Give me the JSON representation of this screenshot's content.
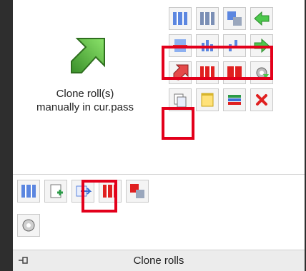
{
  "main": {
    "caption": "Clone roll(s)\nmanually in cur.pass",
    "big_icon": "clone-arrow-icon"
  },
  "grid": [
    [
      "columns-blue-icon",
      "columns-gray-icon",
      "roll-clone-stack-icon",
      "arrow-left-green-icon"
    ],
    [
      "align-center-vertical-icon",
      "align-bottom-icon",
      "align-top-icon",
      "arrow-right-green-icon"
    ],
    [
      "arrow-up-red-icon",
      "columns-red-split-icon",
      "columns-red-split-2-icon",
      "settings-arrow-icon"
    ],
    [
      "copy-pages-icon",
      "notepad-icon",
      "stack-colored-bars-icon",
      "close-red-x-icon"
    ]
  ],
  "bottom_row": [
    "columns-blue-3-icon",
    "add-roll-icon",
    "move-to-icon",
    "columns-red-3-icon",
    "roll-clone-red-icon"
  ],
  "gear_icon": "gear-settings-icon",
  "status": {
    "text": "Clone rolls",
    "pin_icon": "pin-icon"
  },
  "colors": {
    "highlight": "#e3001b",
    "green": "#3cb43c",
    "red": "#e02020",
    "blue": "#3b6fd6"
  }
}
